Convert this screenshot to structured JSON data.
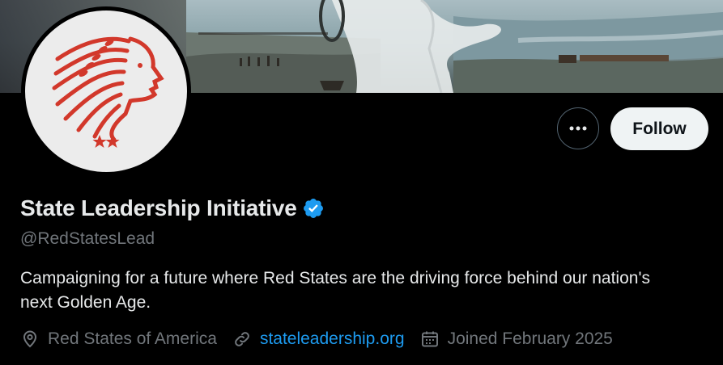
{
  "profile": {
    "name": "State Leadership Initiative",
    "handle": "@RedStatesLead",
    "bio": "Campaigning for a future where Red States are the driving force behind our nation's next Golden Age.",
    "location": "Red States of America",
    "website": "stateleadership.org",
    "joined": "Joined February 2025",
    "verified": true
  },
  "actions": {
    "follow_label": "Follow",
    "more_icon": "more-horizontal-icon"
  },
  "icons": {
    "verified": "verified-badge-icon",
    "location": "location-pin-icon",
    "link": "link-icon",
    "calendar": "calendar-icon"
  },
  "colors": {
    "background": "#000000",
    "accent": "#1d9bf0",
    "text_primary": "#e7e9ea",
    "text_secondary": "#71767b",
    "logo_red": "#d2382b"
  }
}
